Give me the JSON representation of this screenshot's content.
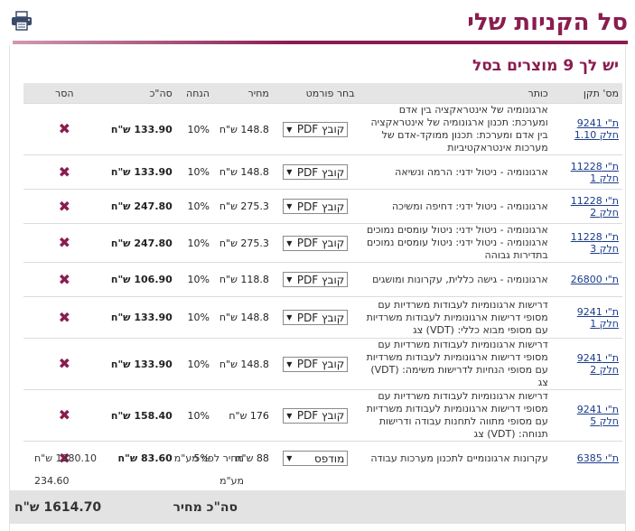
{
  "page": {
    "title": "סל הקניות שלי",
    "subtitle": "יש לך 9 מוצרים בסל"
  },
  "icons": {
    "print": "printer-icon",
    "remove": "remove-x-icon"
  },
  "colors": {
    "accent": "#8a1d4f",
    "link": "#1b3c8c"
  },
  "table": {
    "headers": {
      "catalog": "מס' תקן",
      "title": "כותר",
      "format": "בחר פורמט",
      "price": "מחיר",
      "discount": "הנחה",
      "total": "סה\"כ",
      "remove": "הסר"
    },
    "rows": [
      {
        "catalog": "ת\"י 9241 חלק 1.10",
        "title": "ארגונומיה של אינטראקציה בין אדם ומערכת: תכנון ארגונומיה של אינטראקציה בין אדם ומערכת: תכנון ממוקד-אדם של מערכות אינטראקטיביות",
        "format": "קובץ PDF",
        "price": "148.8 ש\"ח",
        "discount": "10%",
        "total": "133.90 ש\"ח"
      },
      {
        "catalog": "ת\"י 11228 חלק 1",
        "title": "ארגונומיה - ניטול ידני: הרמה ונשיאה",
        "format": "קובץ PDF",
        "price": "148.8 ש\"ח",
        "discount": "10%",
        "total": "133.90 ש\"ח"
      },
      {
        "catalog": "ת\"י 11228 חלק 2",
        "title": "ארגונומיה - ניטול ידני: דחיפה ומשיכה",
        "format": "קובץ PDF",
        "price": "275.3 ש\"ח",
        "discount": "10%",
        "total": "247.80 ש\"ח"
      },
      {
        "catalog": "ת\"י 11228 חלק 3",
        "title": "ארגונומיה - ניטול ידני: ניטול עומסים נמוכים ארגונומיה - ניטול ידני: ניטול עומסים נמוכים בתדירות גבוהה",
        "format": "קובץ PDF",
        "price": "275.3 ש\"ח",
        "discount": "10%",
        "total": "247.80 ש\"ח"
      },
      {
        "catalog": "ת\"י 26800",
        "title": "ארגונומיה - גישה כללית, עקרונות ומושגים",
        "format": "קובץ PDF",
        "price": "118.8 ש\"ח",
        "discount": "10%",
        "total": "106.90 ש\"ח"
      },
      {
        "catalog": "ת\"י 9241 חלק 1",
        "title": "דרישות ארגונומיות לעבודות משרדיות עם מסופי דרישות ארגונומיות לעבודות משרדיות עם מסופי מבוא כללי: (VDT) צג",
        "format": "קובץ PDF",
        "price": "148.8 ש\"ח",
        "discount": "10%",
        "total": "133.90 ש\"ח"
      },
      {
        "catalog": "ת\"י 9241 חלק 2",
        "title": "דרישות ארגונומיות לעבודות משרדיות עם מסופי דרישות ארגונומיות לעבודות משרדיות עם מסופי הנחיות לדרישות משימה: (VDT) צג",
        "format": "קובץ PDF",
        "price": "148.8 ש\"ח",
        "discount": "10%",
        "total": "133.90 ש\"ח"
      },
      {
        "catalog": "ת\"י 9241 חלק 5",
        "title": "דרישות ארגונומיות לעבודות משרדיות עם מסופי דרישות ארגונומיות לעבודות משרדיות עם מסופי מתווה לתחנות עבודה ודרישות תנוחה: (VDT) צג",
        "format": "קובץ PDF",
        "price": "176 ש\"ח",
        "discount": "10%",
        "total": "158.40 ש\"ח"
      },
      {
        "catalog": "ת\"י 6385",
        "title": "עקרונות ארגונומיים לתכנון מערכות עבודה",
        "format": "מודפס",
        "price": "88 ש\"ח",
        "discount": "5%",
        "total": "83.60 ש\"ח"
      }
    ]
  },
  "summary": {
    "subtotal_label": "מחיר לפני מע\"מ",
    "subtotal_value": "1380.10 ש\"ח",
    "vat_label": "מע\"מ",
    "vat_value": "234.60",
    "grand_label": "סה\"כ מחיר",
    "grand_value": "1614.70 ש\"ח"
  }
}
